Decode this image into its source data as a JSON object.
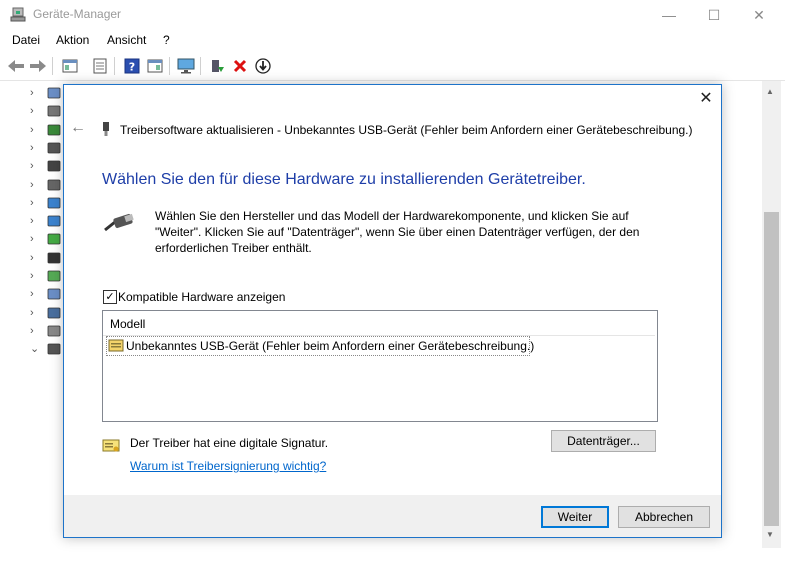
{
  "window": {
    "title": "Geräte-Manager",
    "controls": {
      "minimize": "—",
      "maximize": "☐",
      "close": "✕"
    }
  },
  "menu": [
    "Datei",
    "Aktion",
    "Ansicht",
    "?"
  ],
  "toolbar": {
    "icons": [
      "back-icon",
      "forward-icon",
      "properties-view-icon",
      "list-view-icon",
      "help-icon",
      "details-icon",
      "monitor-icon",
      "update-driver-icon",
      "uninstall-icon",
      "disable-icon"
    ]
  },
  "tree": {
    "rows": [
      {
        "arrow": "›",
        "icon": "audio-icon"
      },
      {
        "arrow": "›",
        "icon": "drive-icon"
      },
      {
        "arrow": "›",
        "icon": "battery-icon"
      },
      {
        "arrow": "›",
        "icon": "usb-icon"
      },
      {
        "arrow": "›",
        "icon": "disk-icon"
      },
      {
        "arrow": "›",
        "icon": "mouse-icon"
      },
      {
        "arrow": "›",
        "icon": "monitor-icon"
      },
      {
        "arrow": "›",
        "icon": "display-icon"
      },
      {
        "arrow": "›",
        "icon": "processor-icon"
      },
      {
        "arrow": "›",
        "icon": "phone-icon"
      },
      {
        "arrow": "›",
        "icon": "sensor-icon"
      },
      {
        "arrow": "›",
        "icon": "controller-icon"
      },
      {
        "arrow": "›",
        "icon": "computer-icon"
      },
      {
        "arrow": "›",
        "icon": "keyboard-icon"
      },
      {
        "arrow": "⌄",
        "icon": "usb-controller-icon"
      }
    ]
  },
  "dialog": {
    "header": "Treibersoftware aktualisieren - Unbekanntes USB-Gerät (Fehler beim Anfordern einer Gerätebeschreibung.)",
    "heading": "Wählen Sie den für diese Hardware zu installierenden Gerätetreiber.",
    "description": "Wählen Sie den Hersteller und das Modell der Hardwarekomponente, und klicken Sie auf \"Weiter\". Klicken Sie auf \"Datenträger\", wenn Sie über einen Datenträger verfügen, der den erforderlichen Treiber enthält.",
    "compatible_checkbox": {
      "label": "Kompatible Hardware anzeigen",
      "checked": true
    },
    "list": {
      "header": "Modell",
      "items": [
        "Unbekanntes USB-Gerät (Fehler beim Anfordern einer Gerätebeschreibung.)"
      ]
    },
    "signature_text": "Der Treiber hat eine digitale Signatur.",
    "signature_link": "Warum ist Treibersignierung wichtig?",
    "disk_button": "Datenträger...",
    "next_button": "Weiter",
    "cancel_button": "Abbrechen",
    "close": "✕",
    "back": "←"
  },
  "colors": {
    "accent": "#1d73c9",
    "heading": "#1e3ea8",
    "link": "#0066cc"
  }
}
